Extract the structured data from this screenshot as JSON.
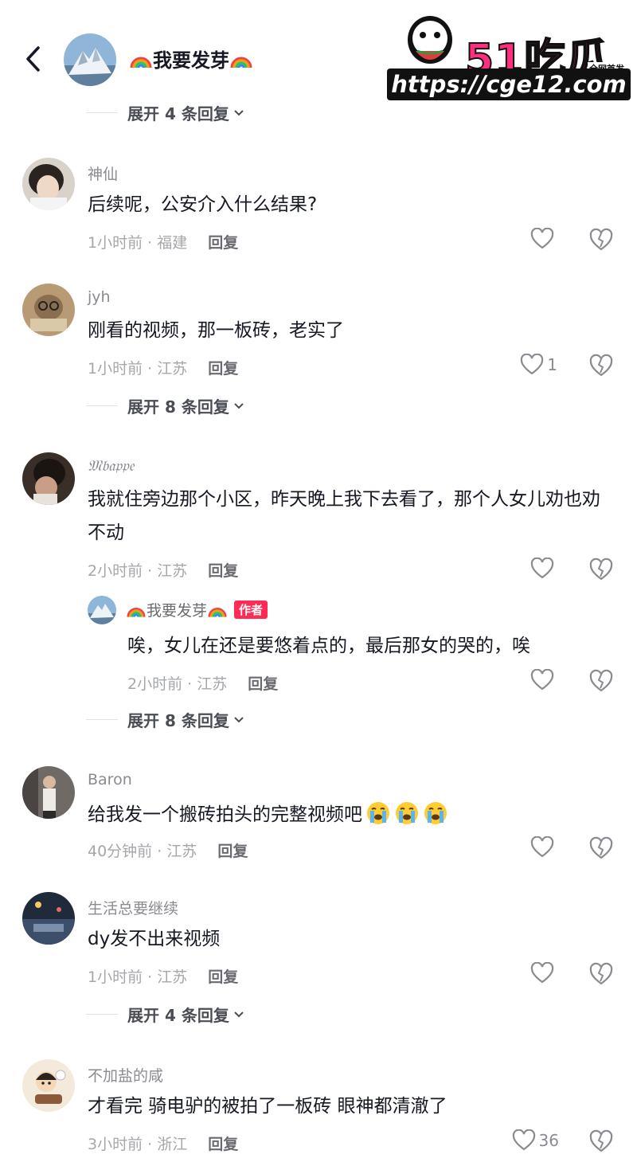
{
  "header": {
    "title": "我要发芽",
    "back_icon": "chevron-left-icon",
    "title_prefix_icon": "rainbow-emoji",
    "title_suffix_icon": "rainbow-emoji"
  },
  "watermark": {
    "brand": "51吃瓜",
    "tag": "全网首发",
    "url": "https://cge12.com",
    "brand_color": "#ff2e7e"
  },
  "expand_rows": [
    {
      "label": "展开 4 条回复"
    },
    {
      "label": "展开 8 条回复"
    },
    {
      "label": "展开 8 条回复"
    },
    {
      "label": "展开 4 条回复"
    }
  ],
  "comments": [
    {
      "username": "神仙",
      "text": "后续呢，公安介入什么结果?",
      "time": "1小时前",
      "location": "福建",
      "reply_label": "回复",
      "likes": ""
    },
    {
      "username": "jyh",
      "text": "刚看的视频，那一板砖，老实了",
      "time": "1小时前",
      "location": "江苏",
      "reply_label": "回复",
      "likes": "1"
    },
    {
      "username": "𝔐𝔟𝔞𝔭𝔭𝔢",
      "text": "我就住旁边那个小区，昨天晚上我下去看了，那个人女儿劝也劝不动",
      "time": "2小时前",
      "location": "江苏",
      "reply_label": "回复",
      "likes": ""
    },
    {
      "username": "Baron",
      "text": "给我发一个搬砖拍头的完整视频吧",
      "time": "40分钟前",
      "location": "江苏",
      "reply_label": "回复",
      "likes": "",
      "emojis": [
        "loudly-crying-emoji",
        "loudly-crying-emoji",
        "loudly-crying-emoji"
      ]
    },
    {
      "username": "生活总要继续",
      "text": "dy发不出来视频",
      "time": "1小时前",
      "location": "江苏",
      "reply_label": "回复",
      "likes": ""
    },
    {
      "username": "不加盐的咸",
      "text": "才看完 骑电驴的被拍了一板砖 眼神都清澈了",
      "time": "3小时前",
      "location": "浙江",
      "reply_label": "回复",
      "likes": "36"
    }
  ],
  "author_reply": {
    "username": "我要发芽",
    "badge": "作者",
    "text": "唉，女儿在还是要悠着点的，最后那女的哭的，唉",
    "time": "2小时前",
    "location": "江苏",
    "reply_label": "回复",
    "likes": ""
  },
  "colors": {
    "accent": "#fe2c55",
    "text_primary": "#161823",
    "text_secondary": "#8a8b91"
  },
  "meta_separator": " · "
}
